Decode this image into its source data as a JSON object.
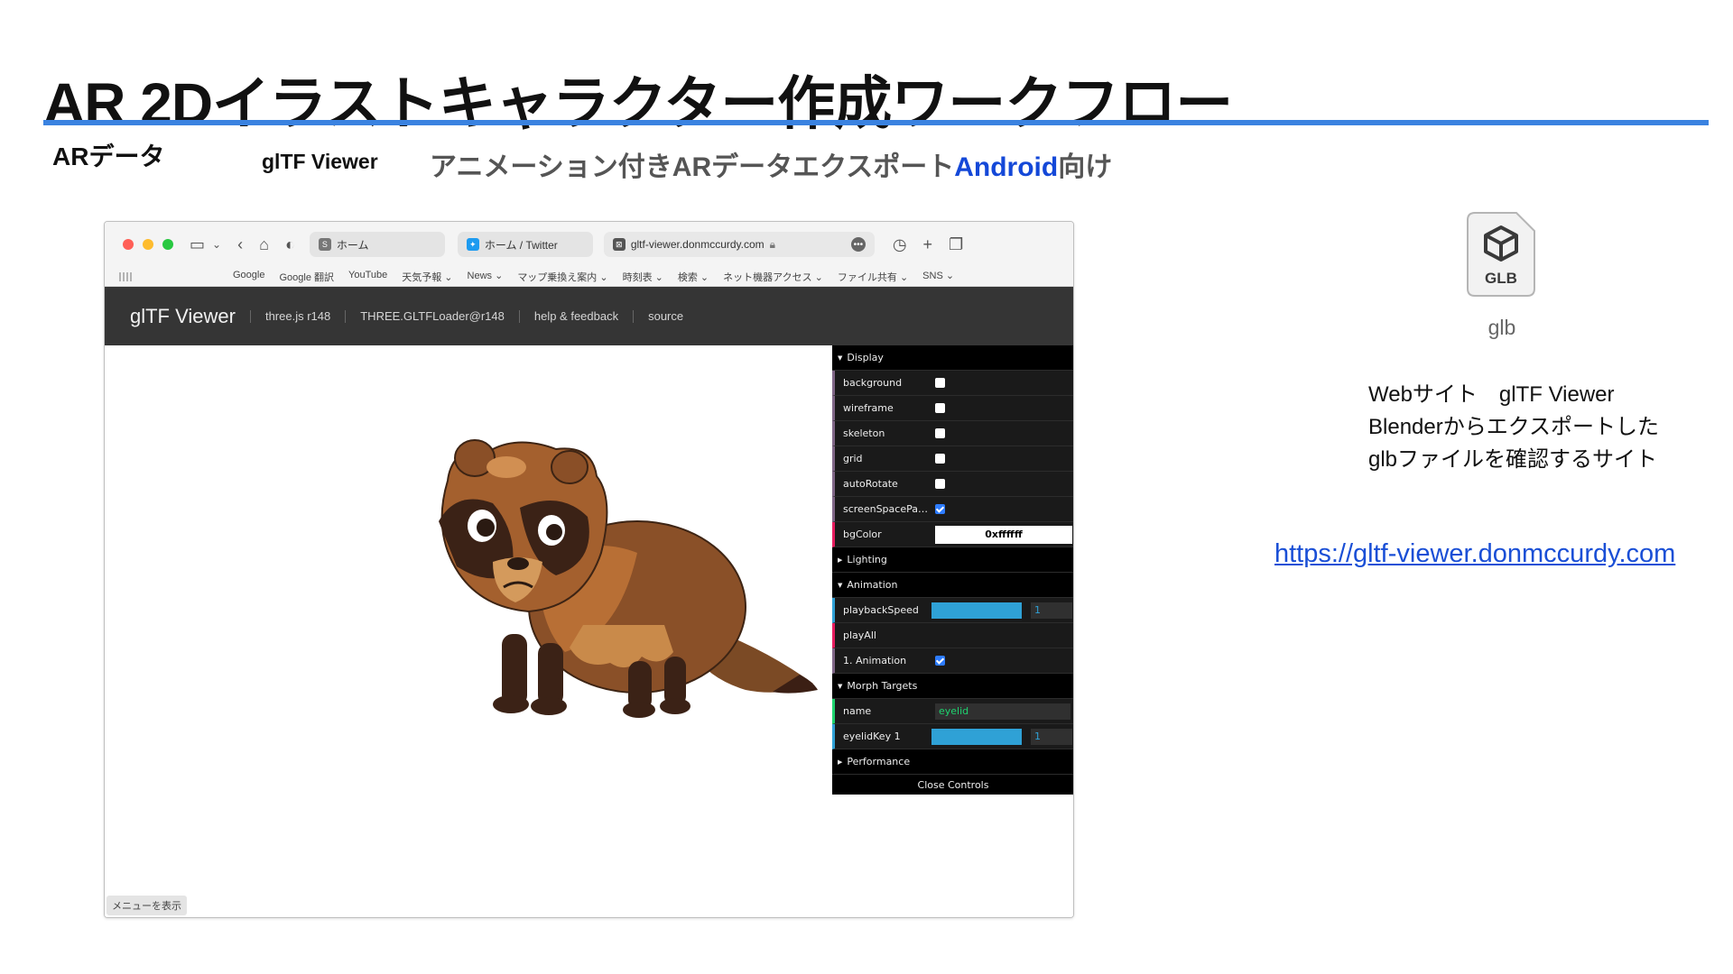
{
  "slide": {
    "title": "AR 2Dイラストキャラクター作成ワークフロー",
    "sub_ardata": "ARデータ",
    "sub_gltf": "glTF Viewer",
    "sub_anim_prefix": "アニメーション付きARデータエクスポート",
    "sub_anim_android": "Android",
    "sub_anim_suffix": "向け",
    "accent_color": "#3a82e0"
  },
  "browser": {
    "tabs": [
      {
        "label": "ホーム",
        "favicon": "S"
      },
      {
        "label": "ホーム / Twitter",
        "favicon": "twitter-bird"
      },
      {
        "label": "gltf-viewer.donmccurdy.com",
        "favicon": "gltf"
      }
    ],
    "bookmarks": [
      "Google",
      "Google 翻訳",
      "YouTube",
      "天気予報 ⌄",
      "News ⌄",
      "マップ乗換え案内 ⌄",
      "時刻表 ⌄",
      "検索 ⌄",
      "ネット機器アクセス ⌄",
      "ファイル共有 ⌄",
      "SNS ⌄"
    ],
    "menu_button": "メニューを表示"
  },
  "viewer": {
    "brand": "glTF Viewer",
    "links": [
      "three.js r148",
      "THREE.GLTFLoader@r148",
      "help & feedback",
      "source"
    ]
  },
  "gui": {
    "display_folder": "Display",
    "display_controls": [
      {
        "label": "background",
        "checked": false
      },
      {
        "label": "wireframe",
        "checked": false
      },
      {
        "label": "skeleton",
        "checked": false
      },
      {
        "label": "grid",
        "checked": false
      },
      {
        "label": "autoRotate",
        "checked": false
      },
      {
        "label": "screenSpacePan...",
        "checked": true
      }
    ],
    "bgcolor_label": "bgColor",
    "bgcolor_value": "0xffffff",
    "lighting_folder": "Lighting",
    "animation_folder": "Animation",
    "playback_label": "playbackSpeed",
    "playback_value": "1",
    "playall_label": "playAll",
    "anim1_label": "1. Animation",
    "morph_folder": "Morph Targets",
    "name_label": "name",
    "name_value": "eyelid",
    "eyelid_label": "eyelidKey 1",
    "eyelid_value": "1",
    "performance_folder": "Performance",
    "close_label": "Close Controls"
  },
  "right": {
    "glb_icon_text": "GLB",
    "glb_caption": "glb",
    "desc_lines": [
      "Webサイト　glTF Viewer",
      "Blenderからエクスポートした",
      "glbファイルを確認するサイト"
    ],
    "url": "https://gltf-viewer.donmccurdy.com"
  }
}
